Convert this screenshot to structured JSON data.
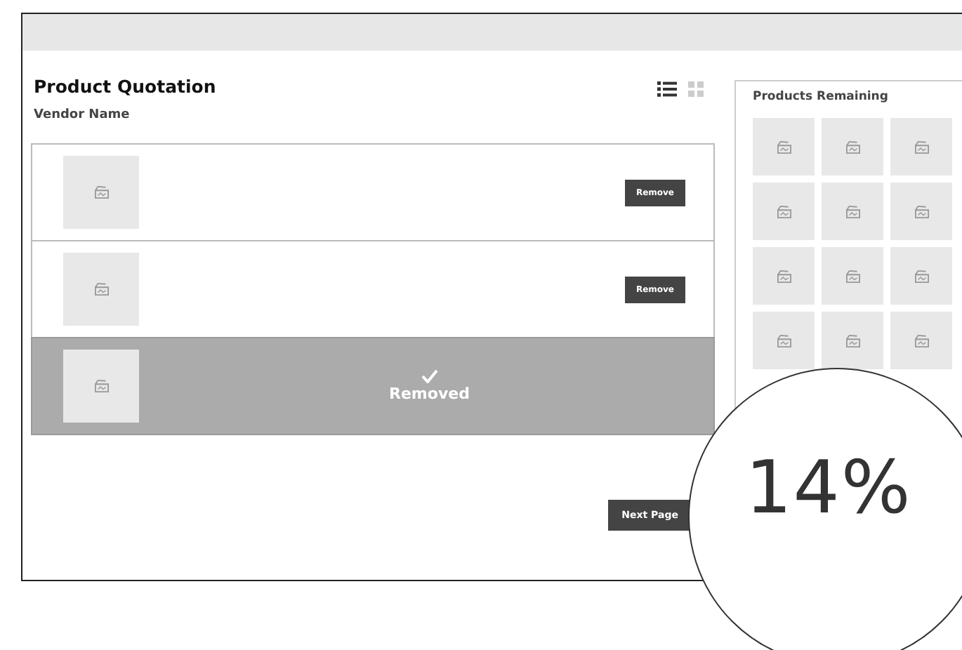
{
  "quotation": {
    "title": "Product Quotation",
    "vendor_label": "Vendor Name",
    "view_toggle": [
      {
        "kind": "list",
        "selected": true
      },
      {
        "kind": "grid",
        "selected": false
      }
    ],
    "rows": [
      {
        "removed": false,
        "action": "Remove"
      },
      {
        "removed": false,
        "action": "Remove"
      },
      {
        "removed": true,
        "status": "Removed"
      }
    ],
    "next_button": "Next Page"
  },
  "products_remaining": {
    "title": "Products Remaining"
  },
  "progress_overlay": {
    "text": "14%"
  }
}
